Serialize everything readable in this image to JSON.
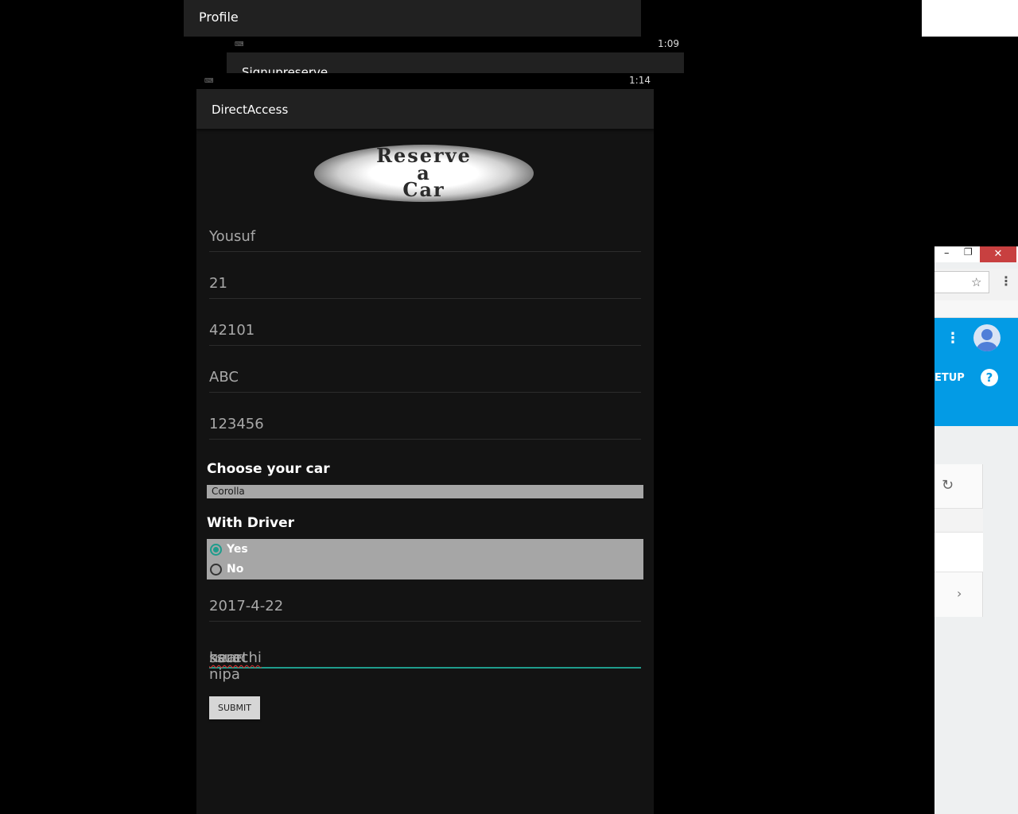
{
  "background_windows": {
    "profile_title": "Profile",
    "signup_time": "1:09",
    "signup_title": "Signupreserve"
  },
  "status_bar": {
    "time": "1:14"
  },
  "app": {
    "title": "DirectAccess",
    "logo_lines": [
      "Reserve",
      "a",
      "Car"
    ],
    "fields": {
      "name": "Yousuf",
      "age": "21",
      "postal_code": "42101",
      "text_field": "ABC",
      "number": "123456",
      "date": "2017-4-22",
      "address_word1": "karachi",
      "address_word2": "ssuet",
      "address_rest": "near nipa"
    },
    "car_label": "Choose your car",
    "car_selected": "Corolla",
    "driver_label": "With Driver",
    "driver_options": [
      "Yes",
      "No"
    ],
    "driver_selected": "Yes",
    "submit_label": "SUBMIT",
    "accent_color": "#1f9c8c"
  },
  "browser": {
    "setup_text": "ETUP",
    "help_symbol": "?",
    "header_color": "#039be5",
    "close_color": "#c84040"
  }
}
